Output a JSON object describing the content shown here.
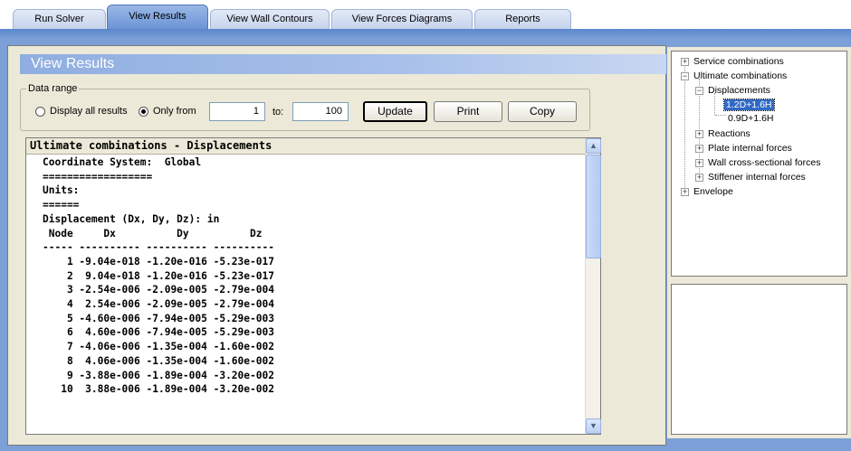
{
  "tabs": [
    {
      "label": "Run Solver"
    },
    {
      "label": "View Results"
    },
    {
      "label": "View Wall Contours"
    },
    {
      "label": "View Forces Diagrams"
    },
    {
      "label": "Reports"
    }
  ],
  "panel": {
    "title": "View Results"
  },
  "data_range": {
    "legend": "Data range",
    "option_all": "Display all results",
    "option_range": "Only from",
    "from_value": "1",
    "to_label": "to:",
    "to_value": "100",
    "selected_option": "Only from"
  },
  "buttons": {
    "update": "Update",
    "print": "Print",
    "copy": "Copy"
  },
  "results": {
    "heading": "Ultimate combinations - Displacements",
    "lines": [
      "Coordinate System:  Global",
      "==================",
      "",
      "Units:",
      "======",
      "Displacement (Dx, Dy, Dz): in",
      "",
      "",
      " Node     Dx          Dy          Dz",
      "----- ---------- ---------- ----------",
      "    1 -9.04e-018 -1.20e-016 -5.23e-017",
      "    2  9.04e-018 -1.20e-016 -5.23e-017",
      "    3 -2.54e-006 -2.09e-005 -2.79e-004",
      "    4  2.54e-006 -2.09e-005 -2.79e-004",
      "    5 -4.60e-006 -7.94e-005 -5.29e-003",
      "    6  4.60e-006 -7.94e-005 -5.29e-003",
      "    7 -4.06e-006 -1.35e-004 -1.60e-002",
      "    8  4.06e-006 -1.35e-004 -1.60e-002",
      "    9 -3.88e-006 -1.89e-004 -3.20e-002",
      "   10  3.88e-006 -1.89e-004 -3.20e-002"
    ]
  },
  "tree": {
    "service": "Service combinations",
    "ultimate": "Ultimate combinations",
    "displacements": "Displacements",
    "combo1": "1.2D+1.6H",
    "combo2": "0.9D+1.6H",
    "reactions": "Reactions",
    "plate": "Plate internal forces",
    "wall": "Wall cross-sectional forces",
    "stiffener": "Stiffener internal forces",
    "envelope": "Envelope"
  },
  "colors": {
    "accent": "#7b9fd6",
    "selection": "#316ac5"
  },
  "icons": {
    "plus": "plus-box-icon",
    "minus": "minus-box-icon",
    "up": "chevron-up-icon",
    "down": "chevron-down-icon"
  }
}
